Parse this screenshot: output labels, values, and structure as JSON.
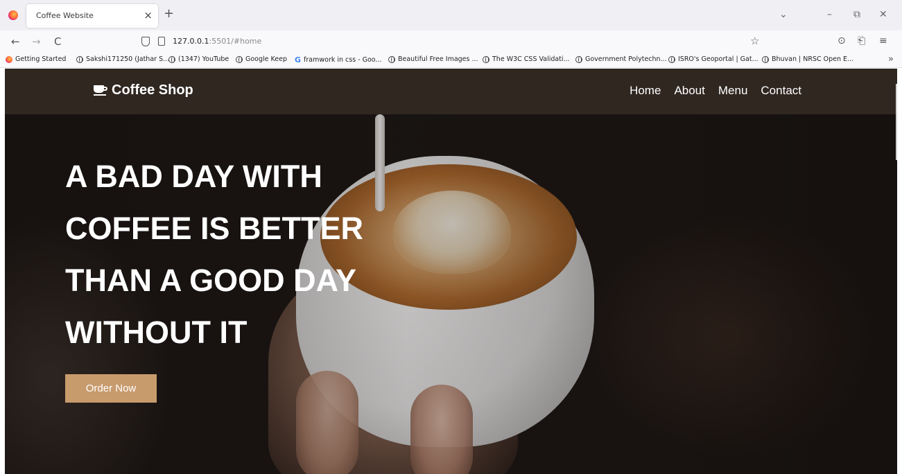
{
  "browser": {
    "tab_title": "Coffee Website",
    "tab_close": "×",
    "new_tab": "+",
    "url_host": "127.0.0.1",
    "url_rest": ":5501/#home",
    "controls": {
      "list": "⌄",
      "minimize": "–",
      "restore": "⧉",
      "close": "✕"
    },
    "nav": {
      "back": "←",
      "forward": "→",
      "reload": "C"
    },
    "bookmark_star": "☆",
    "right_icons": {
      "pocket": "⊙",
      "extensions": "⎗",
      "menu": "≡"
    },
    "bookmarks": [
      "Getting Started",
      "Sakshi171250 (Jathar S...",
      "(1347) YouTube",
      "Google Keep",
      "framwork in css - Goo...",
      "Beautiful Free Images ...",
      "The W3C CSS Validati...",
      "Government Polytechn...",
      "ISRO's Geoportal | Gat...",
      "Bhuvan | NRSC Open E..."
    ],
    "bookmarks_overflow": "»"
  },
  "site": {
    "logo_text": "Coffee Shop",
    "nav": [
      "Home",
      "About",
      "Menu",
      "Contact"
    ],
    "hero": {
      "headline_lines": [
        "A BAD DAY WITH",
        "COFFEE IS BETTER",
        "THAN A GOOD DAY",
        "WITHOUT IT"
      ],
      "button_label": "Order Now"
    },
    "colors": {
      "header_bg": "#302721",
      "button_bg": "#c89b6d",
      "text": "#ffffff"
    }
  }
}
